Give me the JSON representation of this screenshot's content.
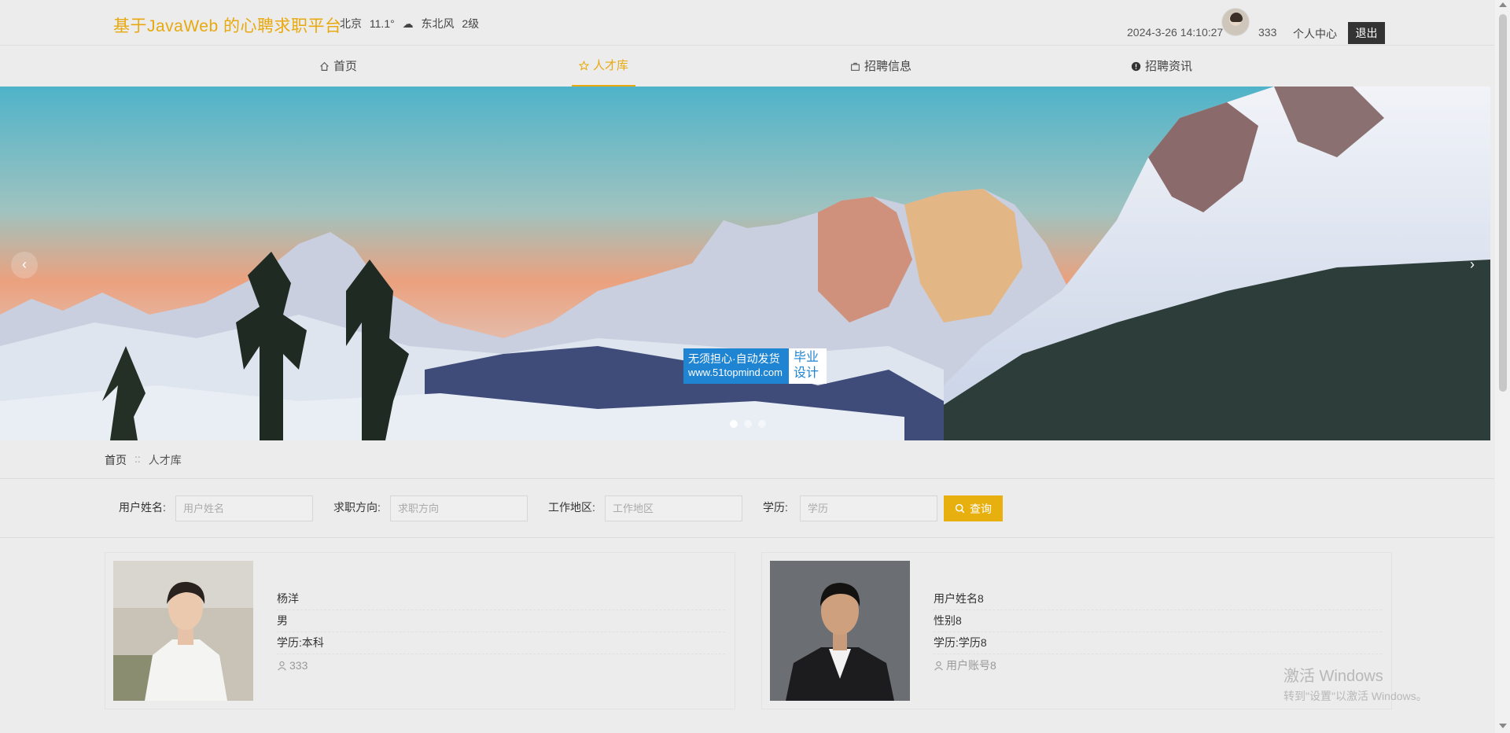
{
  "header": {
    "site_title": "基于JavaWeb 的心聘求职平台",
    "weather": {
      "city": "北京",
      "temp": "11.1°",
      "condition_icon": "cloud-icon",
      "wind": "东北风",
      "wind_level": "2级"
    },
    "datetime": "2024-3-26 14:10:27",
    "username": "333",
    "user_center": "个人中心",
    "logout": "退出"
  },
  "nav": {
    "items": [
      {
        "label": "首页",
        "icon": "home-icon"
      },
      {
        "label": "人才库",
        "icon": "star-icon",
        "active": true
      },
      {
        "label": "招聘信息",
        "icon": "briefcase-icon"
      },
      {
        "label": "招聘资讯",
        "icon": "info-icon"
      }
    ]
  },
  "banner": {
    "prev": "‹",
    "next": "›",
    "slides": 3,
    "active_slide": 0,
    "badge": {
      "line1": "无须担心·自动发货",
      "url": "www.51topmind.com",
      "right": "毕业设计"
    }
  },
  "breadcrumb": {
    "home": "首页",
    "separator": "::",
    "current": "人才库"
  },
  "search": {
    "fields": [
      {
        "label": "用户姓名:",
        "placeholder": "用户姓名"
      },
      {
        "label": "求职方向:",
        "placeholder": "求职方向"
      },
      {
        "label": "工作地区:",
        "placeholder": "工作地区"
      },
      {
        "label": "学历:",
        "placeholder": "学历"
      }
    ],
    "button": "查询"
  },
  "cards": [
    {
      "name": "杨洋",
      "gender": "男",
      "education": "学历:本科",
      "account": "333"
    },
    {
      "name": "用户姓名8",
      "gender": "性别8",
      "education": "学历:学历8",
      "account": "用户账号8"
    }
  ],
  "os_watermark": {
    "line1": "激活 Windows",
    "line2": "转到\"设置\"以激活 Windows。"
  },
  "colors": {
    "accent": "#e8a90f",
    "button": "#e8b00f",
    "logout_bg": "#333333"
  }
}
